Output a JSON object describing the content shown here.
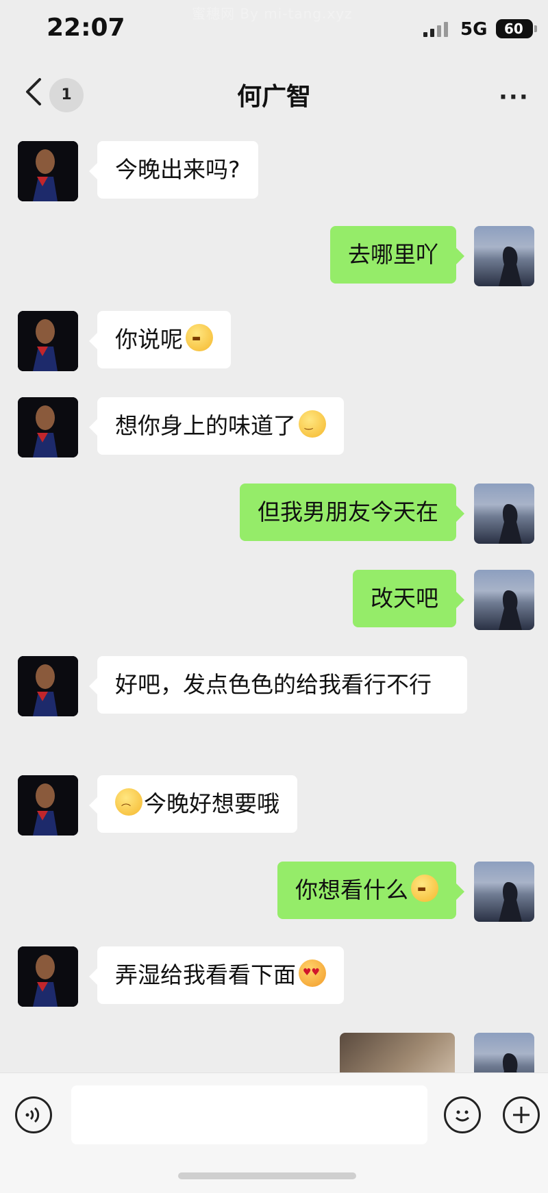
{
  "watermark": "蜜穗网   By  mi-tang.xyz",
  "status_bar": {
    "time": "22:07",
    "network": "5G",
    "battery": "60"
  },
  "nav": {
    "unread_count": "1",
    "chat_name": "何广智",
    "more_label": "···"
  },
  "messages": [
    {
      "side": "left",
      "text": "今晚出来吗?"
    },
    {
      "side": "right",
      "text": "去哪里吖"
    },
    {
      "side": "left",
      "text": "你说呢",
      "emoji": "grin-emoji"
    },
    {
      "side": "left",
      "text": "想你身上的味道了",
      "emoji": "smirk-emoji"
    },
    {
      "side": "right",
      "text": "但我男朋友今天在"
    },
    {
      "side": "right",
      "text": "改天吧"
    },
    {
      "side": "left",
      "text": "好吧，发点色色的给我看行不行"
    },
    {
      "side": "left",
      "text": "今晚好想要哦",
      "emoji": "pleading-emoji"
    },
    {
      "side": "right",
      "text": "你想看什么",
      "emoji": "grin-emoji"
    },
    {
      "side": "left",
      "text": "弄湿给我看看下面",
      "emoji": "heart-eyes-emoji"
    },
    {
      "side": "right",
      "type": "image"
    }
  ],
  "icons": {
    "back": "chevron-left-icon",
    "voice": "voice-icon",
    "emoji": "emoji-icon",
    "plus": "plus-icon"
  }
}
